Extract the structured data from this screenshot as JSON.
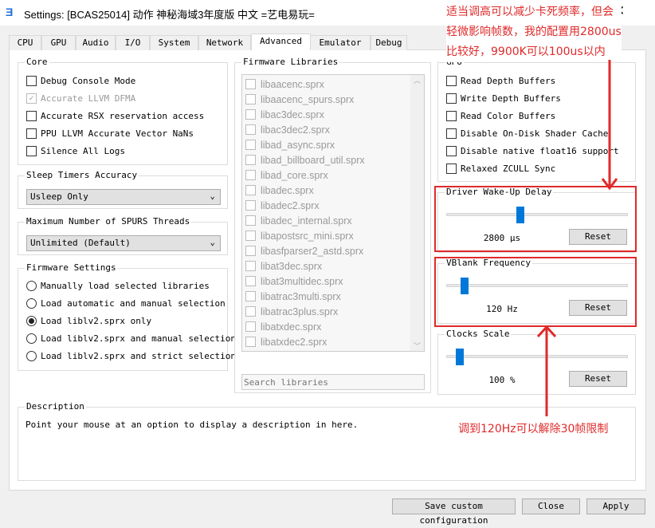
{
  "window": {
    "title": "Settings: [BCAS25014] 动作 神秘海域3年度版 中文 =艺电易玩=",
    "logo": "Ǝ",
    "close": "✕"
  },
  "tabs": [
    "CPU",
    "GPU",
    "Audio",
    "I/O",
    "System",
    "Network",
    "Advanced",
    "Emulator",
    "Debug"
  ],
  "active_tab": "Advanced",
  "core": {
    "title": "Core",
    "items": [
      {
        "label": "Debug Console Mode",
        "checked": false,
        "enabled": true
      },
      {
        "label": "Accurate LLVM DFMA",
        "checked": true,
        "enabled": false
      },
      {
        "label": "Accurate RSX reservation access",
        "checked": false,
        "enabled": true
      },
      {
        "label": "PPU LLVM Accurate Vector NaNs",
        "checked": false,
        "enabled": true
      },
      {
        "label": "Silence All Logs",
        "checked": false,
        "enabled": true
      }
    ]
  },
  "sleep": {
    "title": "Sleep Timers Accuracy",
    "value": "Usleep Only"
  },
  "spurs": {
    "title": "Maximum Number of SPURS Threads",
    "value": "Unlimited (Default)"
  },
  "firmware": {
    "title": "Firmware Settings",
    "options": [
      "Manually load selected libraries",
      "Load automatic and manual selection",
      "Load liblv2.sprx only",
      "Load liblv2.sprx and manual selection",
      "Load liblv2.sprx and strict selection"
    ],
    "selected": 2
  },
  "libraries": {
    "title": "Firmware Libraries",
    "items": [
      "libaacenc.sprx",
      "libaacenc_spurs.sprx",
      "libac3dec.sprx",
      "libac3dec2.sprx",
      "libad_async.sprx",
      "libad_billboard_util.sprx",
      "libad_core.sprx",
      "libadec.sprx",
      "libadec2.sprx",
      "libadec_internal.sprx",
      "libapostsrc_mini.sprx",
      "libasfparser2_astd.sprx",
      "libat3dec.sprx",
      "libat3multidec.sprx",
      "libatrac3multi.sprx",
      "libatrac3plus.sprx",
      "libatxdec.sprx",
      "libatxdec2.sprx"
    ],
    "search_placeholder": "Search libraries"
  },
  "gpu": {
    "title": "GPU",
    "items": [
      "Read Depth Buffers",
      "Write Depth Buffers",
      "Read Color Buffers",
      "Disable On-Disk Shader Cache",
      "Disable native float16 support",
      "Relaxed ZCULL Sync"
    ]
  },
  "sliders": [
    {
      "title": "Driver Wake-Up Delay",
      "value": "2800 µs",
      "position": 0.4,
      "reset": "Reset"
    },
    {
      "title": "VBlank Frequency",
      "value": "120 Hz",
      "position": 0.08,
      "reset": "Reset"
    },
    {
      "title": "Clocks Scale",
      "value": "100 %",
      "position": 0.05,
      "reset": "Reset"
    }
  ],
  "description": {
    "title": "Description",
    "text": "Point your mouse at an option to display a description in here."
  },
  "buttons": {
    "save": "Save custom configuration",
    "close": "Close",
    "apply": "Apply"
  },
  "annotations": {
    "top": [
      "适当调高可以减少卡死频率，但会",
      "轻微影响帧数，我的配置用2800us",
      "比较好，9900K可以100us以内"
    ],
    "bottom": "调到120Hz可以解除30帧限制",
    "color": "#e02a2a"
  }
}
